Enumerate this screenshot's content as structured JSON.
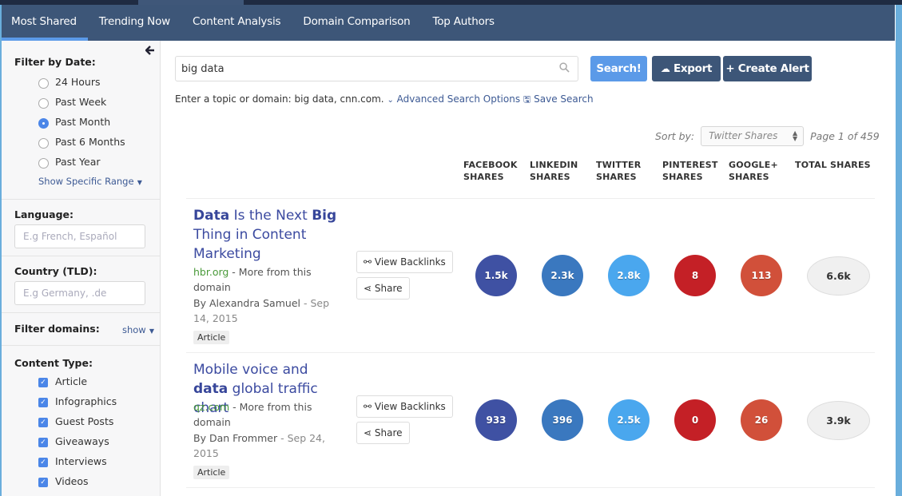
{
  "nav": {
    "tabs": [
      {
        "label": "Most Shared",
        "active": true
      },
      {
        "label": "Trending Now",
        "active": false
      },
      {
        "label": "Content Analysis",
        "active": false
      },
      {
        "label": "Domain Comparison",
        "active": false
      },
      {
        "label": "Top Authors",
        "active": false
      }
    ]
  },
  "sidebar": {
    "collapse_icon": "arrow-left-icon",
    "date_filter": {
      "label": "Filter by Date:",
      "options": [
        "24 Hours",
        "Past Week",
        "Past Month",
        "Past 6 Months",
        "Past Year"
      ],
      "selected": "Past Month",
      "specific_range_link": "Show Specific Range"
    },
    "language": {
      "label": "Language:",
      "placeholder": "E.g French, Español"
    },
    "country": {
      "label": "Country (TLD):",
      "placeholder": "E.g Germany, .de"
    },
    "domains": {
      "label": "Filter domains:",
      "toggle": "show"
    },
    "content_type": {
      "label": "Content Type:",
      "options": [
        {
          "label": "Article",
          "checked": true
        },
        {
          "label": "Infographics",
          "checked": true
        },
        {
          "label": "Guest Posts",
          "checked": true
        },
        {
          "label": "Giveaways",
          "checked": true
        },
        {
          "label": "Interviews",
          "checked": true
        },
        {
          "label": "Videos",
          "checked": true
        }
      ]
    }
  },
  "search": {
    "value": "big data",
    "button": "Search!",
    "export": "Export",
    "create_alert": "+ Create Alert",
    "hint": "Enter a topic or domain: big data, cnn.com.",
    "advanced": "Advanced Search Options",
    "save": "Save Search"
  },
  "sort": {
    "label": "Sort by:",
    "value": "Twitter Shares",
    "page": "Page 1 of 459"
  },
  "columns": [
    {
      "line1": "FACEBOOK",
      "line2": "SHARES"
    },
    {
      "line1": "LINKEDIN",
      "line2": "SHARES"
    },
    {
      "line1": "TWITTER",
      "line2": "SHARES"
    },
    {
      "line1": "PINTEREST",
      "line2": "SHARES"
    },
    {
      "line1": "GOOGLE+",
      "line2": "SHARES"
    },
    {
      "line1": "TOTAL SHARES",
      "line2": ""
    }
  ],
  "colors": {
    "facebook": "#3f51a3",
    "linkedin": "#3a78bf",
    "twitter": "#4aa7ee",
    "pinterest": "#c42026",
    "google": "#d1503a",
    "accent": "#5b9ae8",
    "nav": "#3d5678"
  },
  "results": [
    {
      "title_parts": [
        {
          "text": "Data",
          "bold": true
        },
        {
          "text": " Is the Next ",
          "bold": false
        },
        {
          "text": "Big",
          "bold": true
        },
        {
          "text": " Thing in Content Marketing",
          "bold": false
        }
      ],
      "domain": "hbr.org",
      "more": " - More from this domain",
      "author": "By Alexandra Samuel",
      "date": " - Sep 14, 2015",
      "tag": "Article",
      "view_backlinks": "View Backlinks",
      "share": "Share",
      "facebook": "1.5k",
      "linkedin": "2.3k",
      "twitter": "2.8k",
      "pinterest": "8",
      "google": "113",
      "total": "6.6k"
    },
    {
      "title_parts": [
        {
          "text": "Mobile voice and ",
          "bold": false
        },
        {
          "text": "data",
          "bold": true
        },
        {
          "text": " global traffic chart",
          "bold": false
        }
      ],
      "domain": "qz.com",
      "more": " - More from this domain",
      "author": "By Dan Frommer",
      "date": " - Sep 24, 2015",
      "tag": "Article",
      "view_backlinks": "View Backlinks",
      "share": "Share",
      "facebook": "933",
      "linkedin": "396",
      "twitter": "2.5k",
      "pinterest": "0",
      "google": "26",
      "total": "3.9k"
    }
  ]
}
